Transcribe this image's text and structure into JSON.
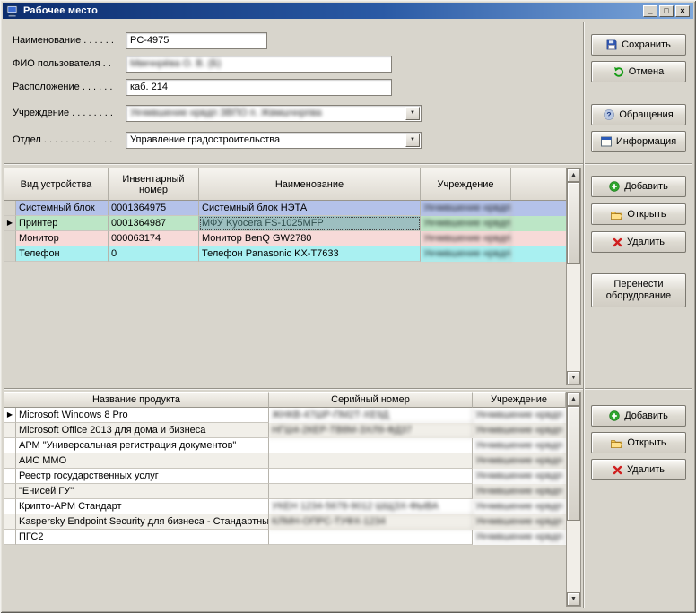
{
  "window": {
    "title": "Рабочее место",
    "minimize_label": "_",
    "maximize_label": "□",
    "close_label": "×"
  },
  "form": {
    "name": {
      "label": "Наименование . . . . . .",
      "value": "PC-4975"
    },
    "user": {
      "label": "ФИО пользователя . .",
      "value": "Мвкчнрёва О. В. (Б)",
      "redacted": true
    },
    "location": {
      "label": "Расположение . . . . . .",
      "value": "каб. 214"
    },
    "organization": {
      "label": "Учреждение . . . . . . . .",
      "value": "Укчмвшение нрвдп ЗВПО п. Жвмшчнрпва",
      "redacted": true
    },
    "department": {
      "label": "Отдел . . . . . . . . . . . . .",
      "value": "Управление градостроительства"
    }
  },
  "buttons": {
    "save": "Сохранить",
    "cancel": "Отмена",
    "appeals": "Обращения",
    "information": "Информация",
    "device_add": "Добавить",
    "device_open": "Открыть",
    "device_delete": "Удалить",
    "device_transfer": "Перенести оборудование",
    "software_add": "Добавить",
    "software_open": "Открыть",
    "software_delete": "Удалить"
  },
  "devices_table": {
    "headers": [
      "Вид устройства",
      "Инвентарный номер",
      "Наименование",
      "Учреждение"
    ],
    "rows": [
      {
        "type": "Системный блок",
        "inv": "0001364975",
        "name": "Системный блок НЭТА",
        "org": "Укчмвшение нрвдп ЗВПО",
        "org_redacted": true,
        "color": "#b4c2e9",
        "marker": false,
        "selected": false
      },
      {
        "type": "Принтер",
        "inv": "0001364987",
        "name": "МФУ Kyocera FS-1025MFP",
        "org": "Укчмвшение нрвдп ЗВПО",
        "org_redacted": true,
        "color": "#bce6c6",
        "marker": true,
        "selected": true
      },
      {
        "type": "Монитор",
        "inv": "000063174",
        "name": "Монитор BenQ GW2780",
        "org": "Укчмвшение нрвдп ЗВПО",
        "org_redacted": true,
        "color": "#f7dad8",
        "marker": false,
        "selected": false
      },
      {
        "type": "Телефон",
        "inv": "0",
        "name": "Телефон Panasonic KX-T7633",
        "org": "Укчмвшение нрвдп ЗВПО",
        "org_redacted": true,
        "color": "#a9f0f1",
        "marker": false,
        "selected": false
      }
    ]
  },
  "software_table": {
    "headers": [
      "Название продукта",
      "Серийный номер",
      "Учреждение"
    ],
    "rows": [
      {
        "name": "Microsoft Windows 8 Pro",
        "serial": "ЖНКВ-47ШР-ПМ2Т-ХЕ9Д",
        "serial_redacted": true,
        "org": "Укчмвшение нрвдп ЗВПО",
        "org_redacted": true,
        "marker": true
      },
      {
        "name": "Microsoft Office 2013 для дома и бизнеса",
        "serial": "НГШ4-2КЕР-ТВ8М-ЗХЛ9-ФД37",
        "serial_redacted": true,
        "org": "Укчмвшение нрвдп ЗВПО",
        "org_redacted": true,
        "marker": false
      },
      {
        "name": "АРМ \"Универсальная регистрация документов\"",
        "serial": "",
        "serial_redacted": false,
        "org": "Укчмвшение нрвдп ЗВПО",
        "org_redacted": true,
        "marker": false
      },
      {
        "name": "АИС ММО",
        "serial": "",
        "serial_redacted": false,
        "org": "Укчмвшение нрвдп ЗВПО",
        "org_redacted": true,
        "marker": false
      },
      {
        "name": "Реестр государственных услуг",
        "serial": "",
        "serial_redacted": false,
        "org": "Укчмвшение нрвдп ЗВПО",
        "org_redacted": true,
        "marker": false
      },
      {
        "name": "\"Енисей ГУ\"",
        "serial": "",
        "serial_redacted": false,
        "org": "Укчмвшение нрвдп ЗВПО",
        "org_redacted": true,
        "marker": false
      },
      {
        "name": "Крипто-АРМ Стандарт",
        "serial": "УКЕН 1234-5678-9012 ШЩЗХ-ФЫВА",
        "serial_redacted": true,
        "org": "Укчмвшение нрвдп ЗВПО",
        "org_redacted": true,
        "marker": false
      },
      {
        "name": "Kaspersky Endpoint Security для бизнеса - Стандартны",
        "serial": "КЛМН-ОПРС-ТУФХ-1234",
        "serial_redacted": true,
        "org": "Укчмвшение нрвдп ЗВПО",
        "org_redacted": true,
        "marker": false
      },
      {
        "name": "ПГС2",
        "serial": "",
        "serial_redacted": false,
        "org": "Укчмвшение нрвдп ЗВПО",
        "org_redacted": true,
        "marker": false
      }
    ]
  }
}
